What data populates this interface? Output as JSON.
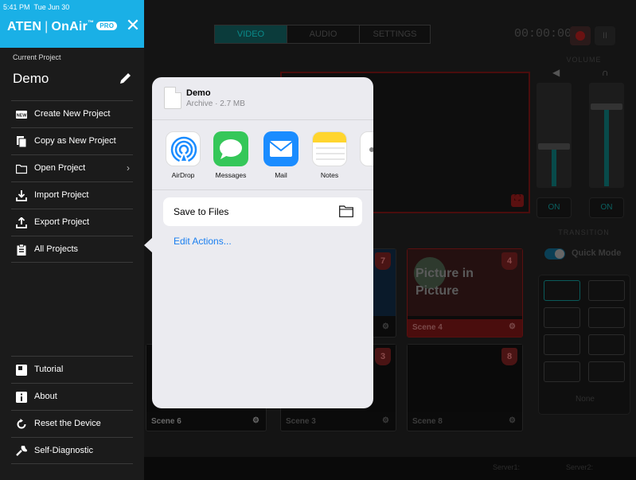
{
  "status_bar": {
    "time": "5:41 PM",
    "date": "Tue Jun 30"
  },
  "brand": {
    "name": "ATEN",
    "product": "OnAir",
    "trademark": "™",
    "badge": "PRO"
  },
  "project": {
    "label": "Current Project",
    "name": "Demo"
  },
  "menu": [
    {
      "label": "Create New Project",
      "icon": "new-icon"
    },
    {
      "label": "Copy as New Project",
      "icon": "copy-icon"
    },
    {
      "label": "Open Project",
      "icon": "folder-icon",
      "chevron": "›"
    },
    {
      "label": "Import Project",
      "icon": "import-icon"
    },
    {
      "label": "Export Project",
      "icon": "export-icon"
    },
    {
      "label": "All Projects",
      "icon": "clipboard-icon"
    }
  ],
  "bottom_menu": [
    {
      "label": "Tutorial",
      "icon": "tutorial-icon"
    },
    {
      "label": "About",
      "icon": "info-icon"
    },
    {
      "label": "Reset the Device",
      "icon": "reset-icon"
    },
    {
      "label": "Self-Diagnostic",
      "icon": "wrench-icon"
    }
  ],
  "share_sheet": {
    "file_name": "Demo",
    "file_meta": "Archive · 2.7 MB",
    "apps": [
      {
        "label": "AirDrop",
        "icon": "airdrop-icon"
      },
      {
        "label": "Messages",
        "icon": "messages-icon"
      },
      {
        "label": "Mail",
        "icon": "mail-icon"
      },
      {
        "label": "Notes",
        "icon": "notes-icon"
      }
    ],
    "save_to_files": "Save to Files",
    "edit_actions": "Edit Actions..."
  },
  "background_app": {
    "tabs": [
      "VIDEO",
      "AUDIO",
      "SETTINGS"
    ],
    "timer": "00:00:00",
    "pause": "II",
    "volume_label": "VOLUME",
    "transition_label": "TRANSITION",
    "quick_mode": "Quick Mode",
    "on_labels": [
      "ON",
      "ON"
    ],
    "none_label": "None",
    "scenes": [
      {
        "number": "7",
        "label": ""
      },
      {
        "number": "4",
        "label": "Scene 4",
        "overlay_line1": "Picture in",
        "overlay_line2": "Picture"
      },
      {
        "number": "3",
        "label": "Scene 3"
      },
      {
        "number": "8",
        "label": "Scene 8"
      },
      {
        "number": "",
        "label": "Scene 6"
      }
    ],
    "status": {
      "server1": "Server1:",
      "server2": "Server2:"
    }
  },
  "colors": {
    "panel_header": "#1ab0e6",
    "link_blue": "#1a7ff0",
    "sheet_bg": "#ebebf0"
  }
}
